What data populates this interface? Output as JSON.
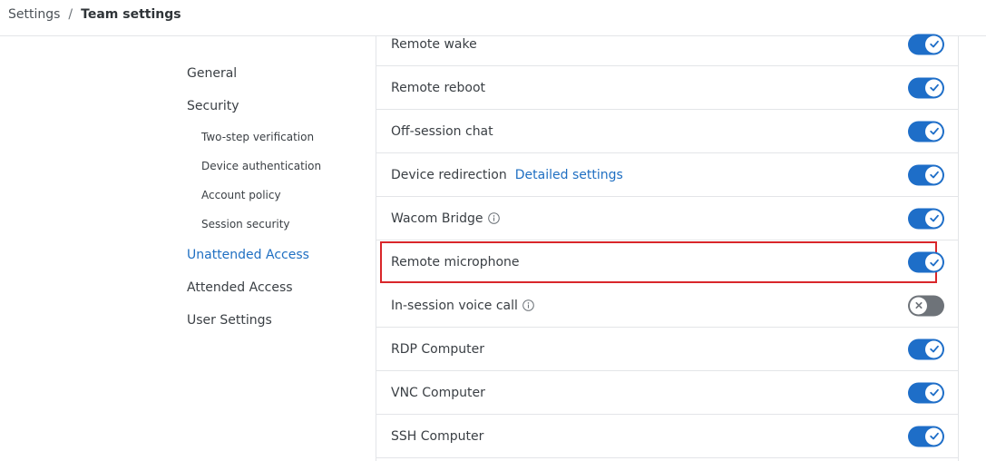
{
  "breadcrumb": {
    "root": "Settings",
    "separator": "/",
    "current": "Team settings"
  },
  "sidebar": {
    "items": [
      {
        "label": "General"
      },
      {
        "label": "Security"
      },
      {
        "label": "Two-step verification"
      },
      {
        "label": "Device authentication"
      },
      {
        "label": "Account policy"
      },
      {
        "label": "Session security"
      },
      {
        "label": "Unattended Access"
      },
      {
        "label": "Attended Access"
      },
      {
        "label": "User Settings"
      }
    ],
    "active": "Unattended Access"
  },
  "settings": {
    "rows": [
      {
        "label": "Remote wake",
        "enabled": true
      },
      {
        "label": "Remote reboot",
        "enabled": true
      },
      {
        "label": "Off-session chat",
        "enabled": true
      },
      {
        "label": "Device redirection",
        "link": "Detailed settings",
        "enabled": true
      },
      {
        "label": "Wacom Bridge",
        "info": "info-icon",
        "enabled": true
      },
      {
        "label": "Remote microphone",
        "enabled": true,
        "highlighted": true
      },
      {
        "label": "In-session voice call",
        "info": "info-icon",
        "enabled": false
      },
      {
        "label": "RDP Computer",
        "enabled": true
      },
      {
        "label": "VNC Computer",
        "enabled": true
      },
      {
        "label": "SSH Computer",
        "enabled": true
      }
    ]
  },
  "colors": {
    "accent": "#1e6ec8",
    "link": "#1f6fc2",
    "toggle_off": "#6e7379",
    "highlight_border": "#d9262a"
  },
  "icons": {
    "toggle_on": "checkmark-icon",
    "toggle_off": "x-icon",
    "info": "info-icon"
  }
}
